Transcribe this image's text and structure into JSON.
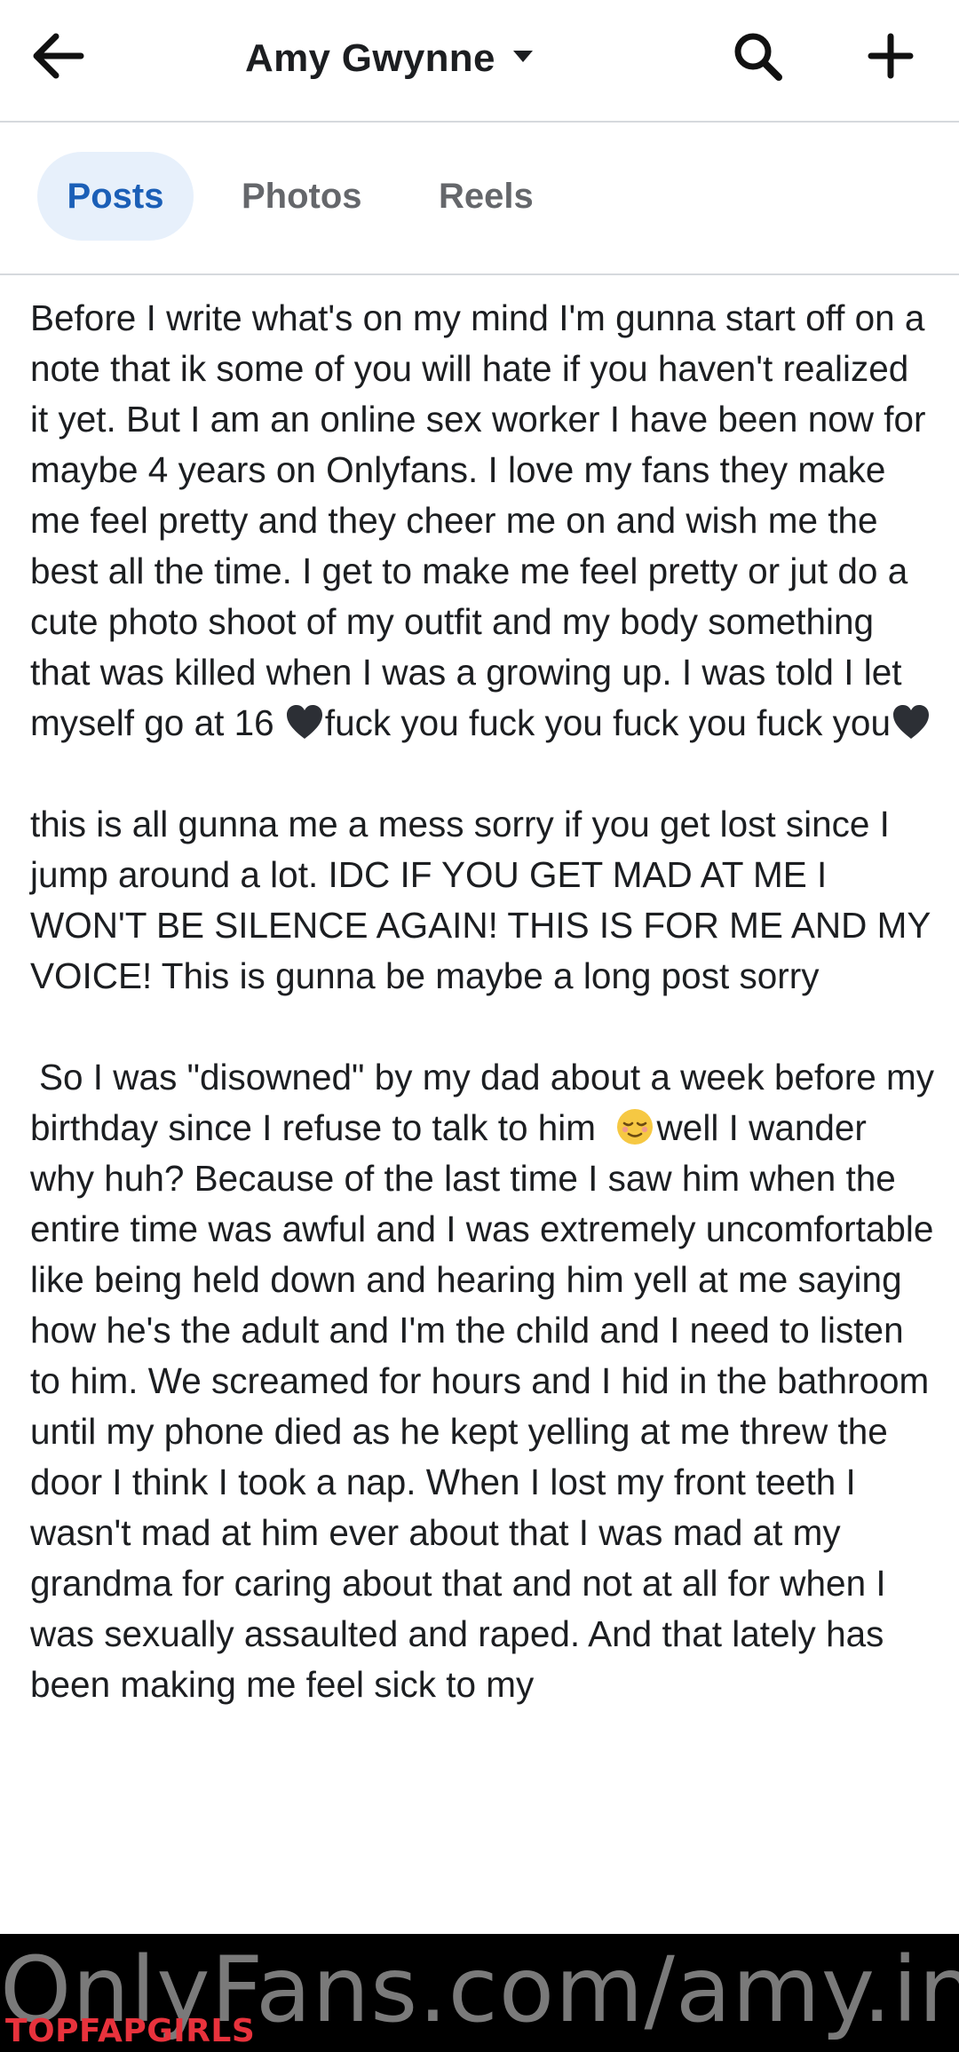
{
  "header": {
    "title": "Amy Gwynne",
    "back_icon": "arrow-left-icon",
    "dropdown_icon": "caret-down-icon",
    "search_icon": "search-icon",
    "add_icon": "plus-icon"
  },
  "tabs": [
    {
      "label": "Posts",
      "active": true
    },
    {
      "label": "Photos",
      "active": false
    },
    {
      "label": "Reels",
      "active": false
    }
  ],
  "post": {
    "paragraphs": [
      {
        "text": "Before I write what's on my mind I'm gunna start off on a note that ik some of you will hate if you haven't realized it yet. But I am an online sex worker I have been now for maybe 4 years on Onlyfans. I love my fans they make me feel pretty and they cheer me on and wish me the best all the time. I get to make me feel pretty or jut do a cute photo shoot of my outfit and my body something that was killed when I was a growing up. I was told I let myself go at 16 ",
        "tail_1": "fuck you fuck you fuck you fuck you",
        "emoji": "black-heart"
      },
      {
        "text": "this is all gunna me a mess sorry if you get lost since I jump around a lot. IDC IF YOU GET MAD AT ME I WON'T BE SILENCE AGAIN! THIS IS FOR ME AND MY VOICE! This is gunna be maybe a long post sorry"
      },
      {
        "text_before_emoji": "So I was \"disowned\" by my dad about a week before my birthday since I refuse to talk to him ",
        "text_after_emoji": " well I wander why huh? Because of the last time I saw him when the entire time was awful and I was extremely uncomfortable like being held down and hearing him yell at me saying how he's the adult and I'm the child and I need to listen to him. We screamed for hours and I hid in the bathroom until my phone died as he kept yelling at me threw the door I think I took a nap. When I lost my front teeth I wasn't mad at him ever about that I was mad at my grandma for caring about that and not at all for when I was sexually assaulted and raped. And that lately has been making me feel sick to my",
        "emoji": "relieved-face"
      }
    ]
  },
  "watermark": {
    "url": "OnlyFans.com/amy.insani",
    "brand": "TOPFAPGIRLS"
  },
  "colors": {
    "active_tab_bg": "#e7f0fb",
    "active_tab_text": "#1b5fb7",
    "inactive_tab_text": "#65676b",
    "brand_red": "#e8323c"
  }
}
